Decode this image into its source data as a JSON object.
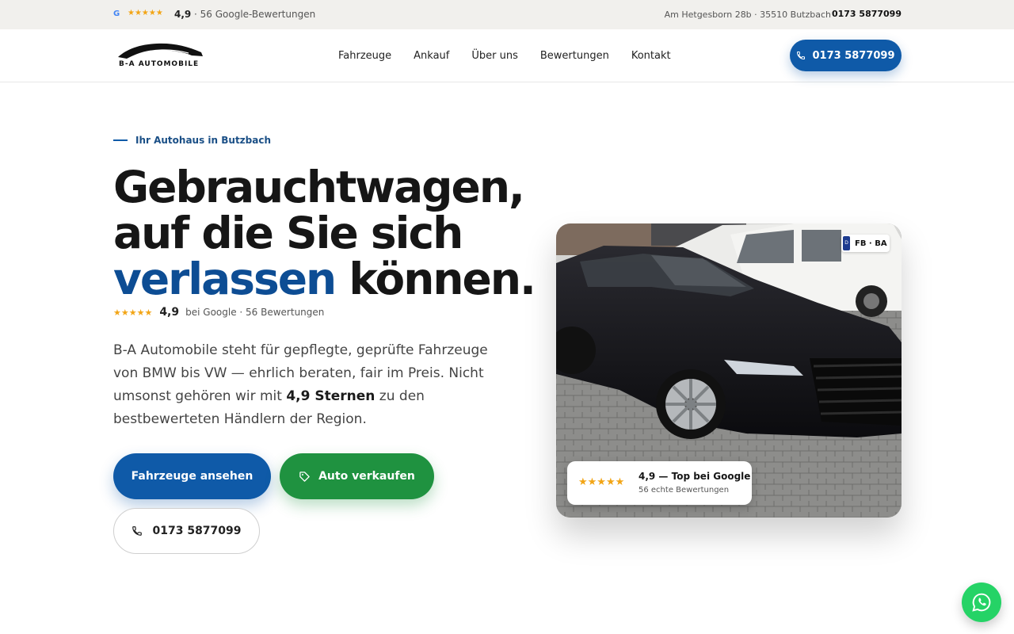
{
  "topbar": {
    "google_letter": "G",
    "stars": "★★★★★",
    "rating": "4,9",
    "reviews": "· 56 Google-Bewertungen",
    "address": "Am Hetgesborn 28b · 35510 Butzbach",
    "phone": "0173 5877099"
  },
  "header": {
    "logo_text": "B-A AUTOMOBILE",
    "nav": [
      "Fahrzeuge",
      "Ankauf",
      "Über uns",
      "Bewertungen",
      "Kontakt"
    ],
    "call_label": "0173 5877099"
  },
  "hero": {
    "eyebrow": "Ihr Autohaus in Butzbach",
    "headline_line1": "Gebrauchtwagen,",
    "headline_line2": "auf die Sie sich",
    "headline_accent": "verlassen",
    "headline_line3_rest": " können.",
    "stars": "★★★★★",
    "rating": "4,9",
    "rating_text": "bei Google · 56 Bewertungen",
    "desc_part1": "B-A Automobile steht für gepflegte, geprüfte Fahrzeuge von BMW bis VW — ehrlich beraten, fair im Preis. Nicht umsonst gehören wir mit ",
    "desc_bold": "4,9 Sternen",
    "desc_part2": " zu den bestbewerteten Händlern der Region.",
    "btn_primary": "Fahrzeuge ansehen",
    "btn_green": "Auto verkaufen",
    "btn_outline": "0173 5877099"
  },
  "card": {
    "plate_eu": "D",
    "plate_text": "FB · BA",
    "badge_stars": "★★★★★",
    "badge_title": "4,9 — Top bei Google",
    "badge_sub": "56 echte Bewertungen"
  },
  "colors": {
    "brand_blue": "#0f5aa8",
    "accent_blue": "#0d4d94",
    "green": "#1f9240",
    "star": "#f2a516",
    "whatsapp": "#25d366"
  },
  "icons": [
    "google-icon",
    "phone-icon",
    "tag-icon",
    "whatsapp-icon",
    "car-logo-icon"
  ]
}
